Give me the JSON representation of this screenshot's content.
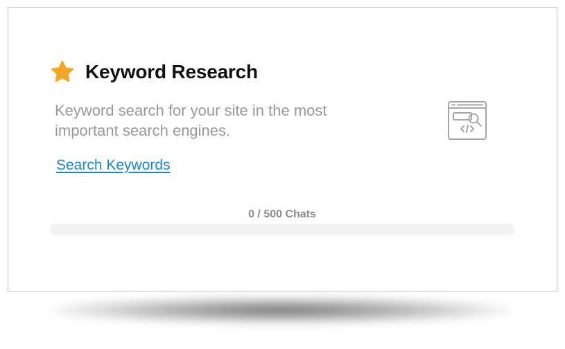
{
  "card": {
    "title": "Keyword Research",
    "description": "Keyword search for your site in the most important search engines.",
    "link_label": "Search Keywords",
    "title_icon": "star-icon",
    "feature_icon": "browser-search-icon",
    "usage": {
      "label": "0 / 500 Chats",
      "used": 0,
      "total": 500,
      "fraction": 0
    }
  },
  "colors": {
    "star": "#F5A623",
    "link": "#1A86D0",
    "description": "#999999",
    "title": "#111111",
    "track": "#F2F2F2"
  }
}
